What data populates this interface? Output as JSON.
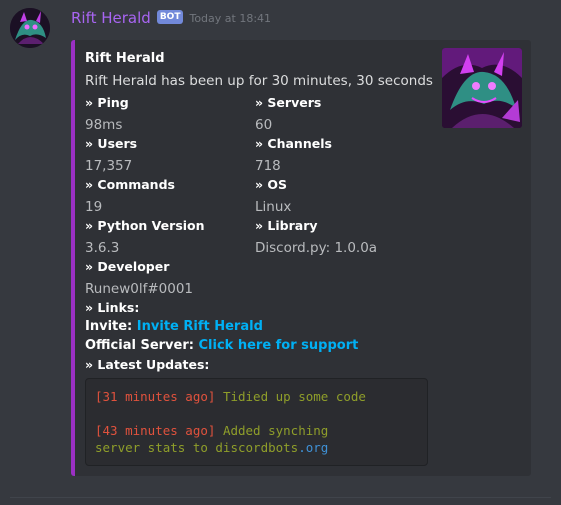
{
  "message": {
    "username": "Rift Herald",
    "bot_tag": "BOT",
    "timestamp": "Today at 18:41",
    "accent_color": "#9b30c4",
    "username_color": "#a865f2"
  },
  "embed": {
    "title": "Rift Herald",
    "description": "Rift Herald has been up for 30 minutes, 30 seconds",
    "fields": [
      {
        "name": "» Ping",
        "value": "98ms"
      },
      {
        "name": "» Servers",
        "value": "60"
      },
      {
        "name": "» Users",
        "value": "17,357"
      },
      {
        "name": "» Channels",
        "value": "718"
      },
      {
        "name": "» Commands",
        "value": "19"
      },
      {
        "name": "» OS",
        "value": "Linux"
      },
      {
        "name": "» Python Version",
        "value": "3.6.3"
      },
      {
        "name": "» Library",
        "value": "Discord.py: 1.0.0a"
      },
      {
        "name": "» Developer",
        "value": "Runew0lf#0001"
      }
    ],
    "links": {
      "name": "» Links:",
      "invite_label": "Invite:",
      "invite_link": "Invite Rift Herald",
      "server_label": "Official Server:",
      "server_link": "Click here for support"
    },
    "updates": {
      "name": "» Latest Updates:",
      "items": [
        {
          "time": "[31 minutes ago]",
          "text": "Tidied up some code"
        },
        {
          "time": "[43 minutes ago]",
          "text_line1": "Added synching",
          "text_line2": "server stats to discordbots",
          "text_suffix": ".org"
        }
      ]
    }
  }
}
